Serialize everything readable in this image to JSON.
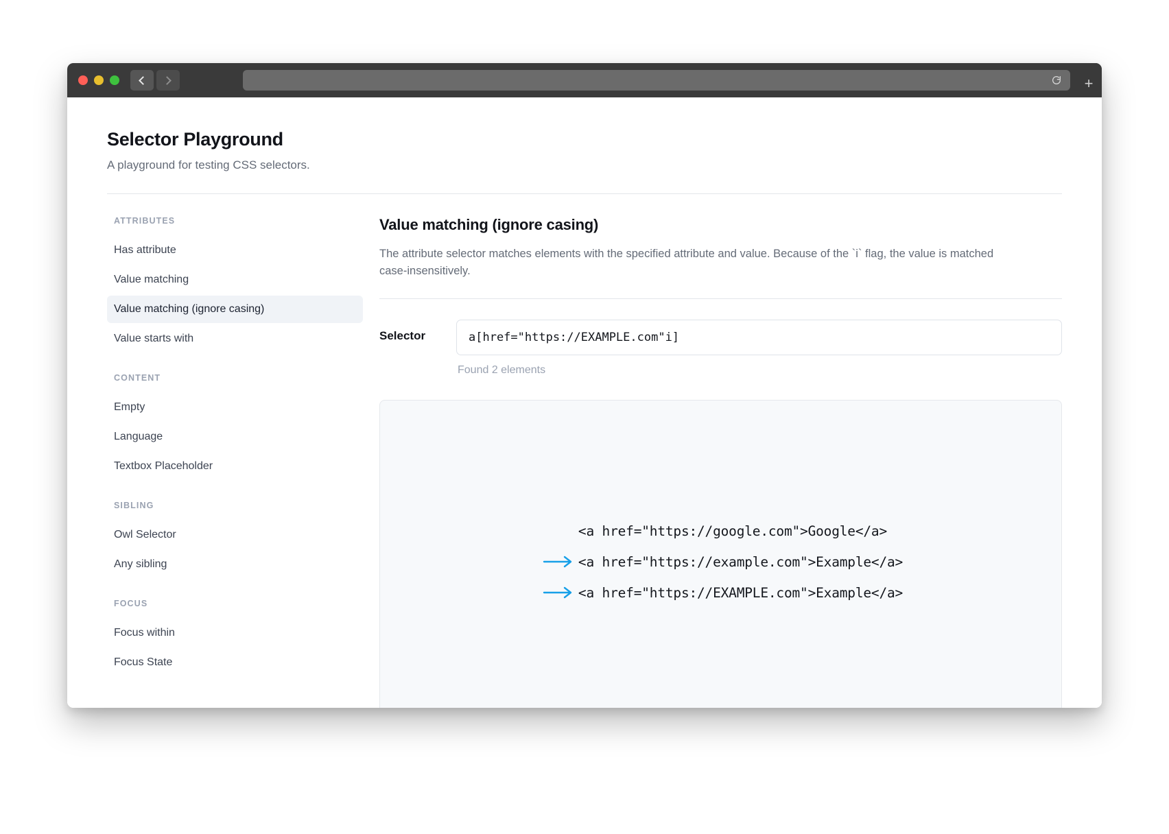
{
  "browser": {
    "traffic_lights": [
      "close",
      "minimize",
      "maximize"
    ],
    "back_label": "‹",
    "forward_label": "›",
    "url_value": "",
    "url_placeholder": "",
    "reload_label": "↻",
    "new_tab_label": "+"
  },
  "header": {
    "title": "Selector Playground",
    "subtitle": "A playground for testing CSS selectors."
  },
  "sidebar": {
    "groups": [
      {
        "heading": "ATTRIBUTES",
        "items": [
          {
            "label": "Has attribute",
            "active": false
          },
          {
            "label": "Value matching",
            "active": false
          },
          {
            "label": "Value matching (ignore casing)",
            "active": true
          },
          {
            "label": "Value starts with",
            "active": false
          }
        ]
      },
      {
        "heading": "CONTENT",
        "items": [
          {
            "label": "Empty",
            "active": false
          },
          {
            "label": "Language",
            "active": false
          },
          {
            "label": "Textbox Placeholder",
            "active": false
          }
        ]
      },
      {
        "heading": "SIBLING",
        "items": [
          {
            "label": "Owl Selector",
            "active": false
          },
          {
            "label": "Any sibling",
            "active": false
          }
        ]
      },
      {
        "heading": "FOCUS",
        "items": [
          {
            "label": "Focus within",
            "active": false
          },
          {
            "label": "Focus State",
            "active": false
          }
        ]
      }
    ]
  },
  "main": {
    "title": "Value matching (ignore casing)",
    "description": "The attribute selector matches elements with the specified attribute and value. Because of the `i` flag, the value is matched case-insensitively.",
    "selector": {
      "label": "Selector",
      "value": "a[href=\"https://EXAMPLE.com\"i]",
      "placeholder": "Enter a CSS selector",
      "result_text": "Found 2 elements"
    },
    "preview": {
      "match_arrow_color": "#17a0e8",
      "lines": [
        {
          "code": "<a href=\"https://google.com\">Google</a>",
          "matched": false
        },
        {
          "code": "<a href=\"https://example.com\">Example</a>",
          "matched": true
        },
        {
          "code": "<a href=\"https://EXAMPLE.com\">Example</a>",
          "matched": true
        }
      ]
    }
  },
  "colors": {
    "accent": "#17a0e8",
    "active_item_bg": "#f0f3f7",
    "muted_text": "#9aa2b1",
    "body_text": "#3c4351"
  }
}
